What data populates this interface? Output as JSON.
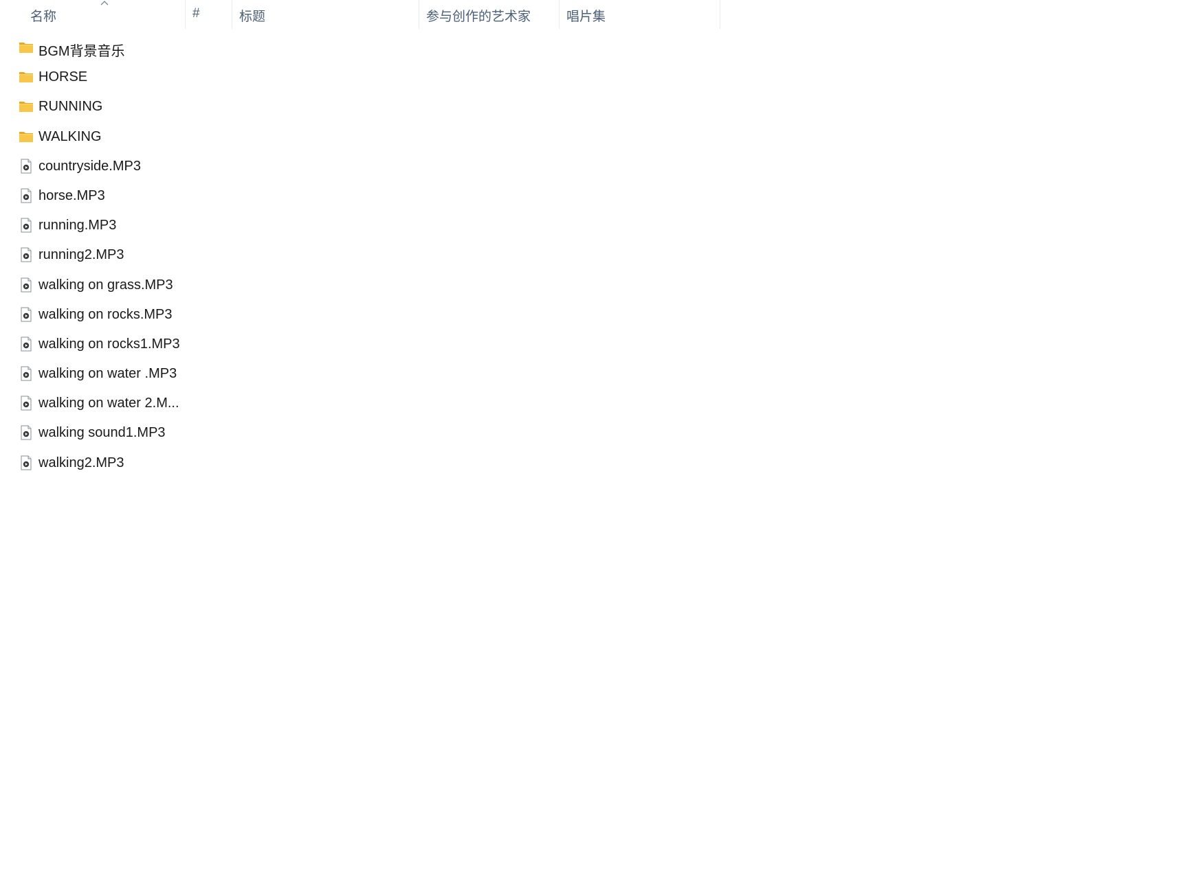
{
  "header": {
    "columns": {
      "name": "名称",
      "number": "#",
      "title": "标题",
      "artist": "参与创作的艺术家",
      "album": "唱片集"
    }
  },
  "files": [
    {
      "name": "BGM背景音乐",
      "type": "folder"
    },
    {
      "name": "HORSE",
      "type": "folder"
    },
    {
      "name": "RUNNING",
      "type": "folder"
    },
    {
      "name": "WALKING",
      "type": "folder"
    },
    {
      "name": "countryside.MP3",
      "type": "audio"
    },
    {
      "name": "horse.MP3",
      "type": "audio"
    },
    {
      "name": "running.MP3",
      "type": "audio"
    },
    {
      "name": "running2.MP3",
      "type": "audio"
    },
    {
      "name": "walking on grass.MP3",
      "type": "audio"
    },
    {
      "name": "walking on rocks.MP3",
      "type": "audio"
    },
    {
      "name": "walking on rocks1.MP3",
      "type": "audio"
    },
    {
      "name": "walking on water .MP3",
      "type": "audio"
    },
    {
      "name": "walking on water 2.M...",
      "type": "audio"
    },
    {
      "name": "walking sound1.MP3",
      "type": "audio"
    },
    {
      "name": "walking2.MP3",
      "type": "audio"
    }
  ],
  "icons": {
    "folder": "folder-icon",
    "audio": "audio-file-icon",
    "sort": "sort-ascending-icon"
  },
  "colors": {
    "header_text": "#4c607a",
    "folder_yellow": "#f8c648",
    "folder_dark": "#e8a820"
  }
}
